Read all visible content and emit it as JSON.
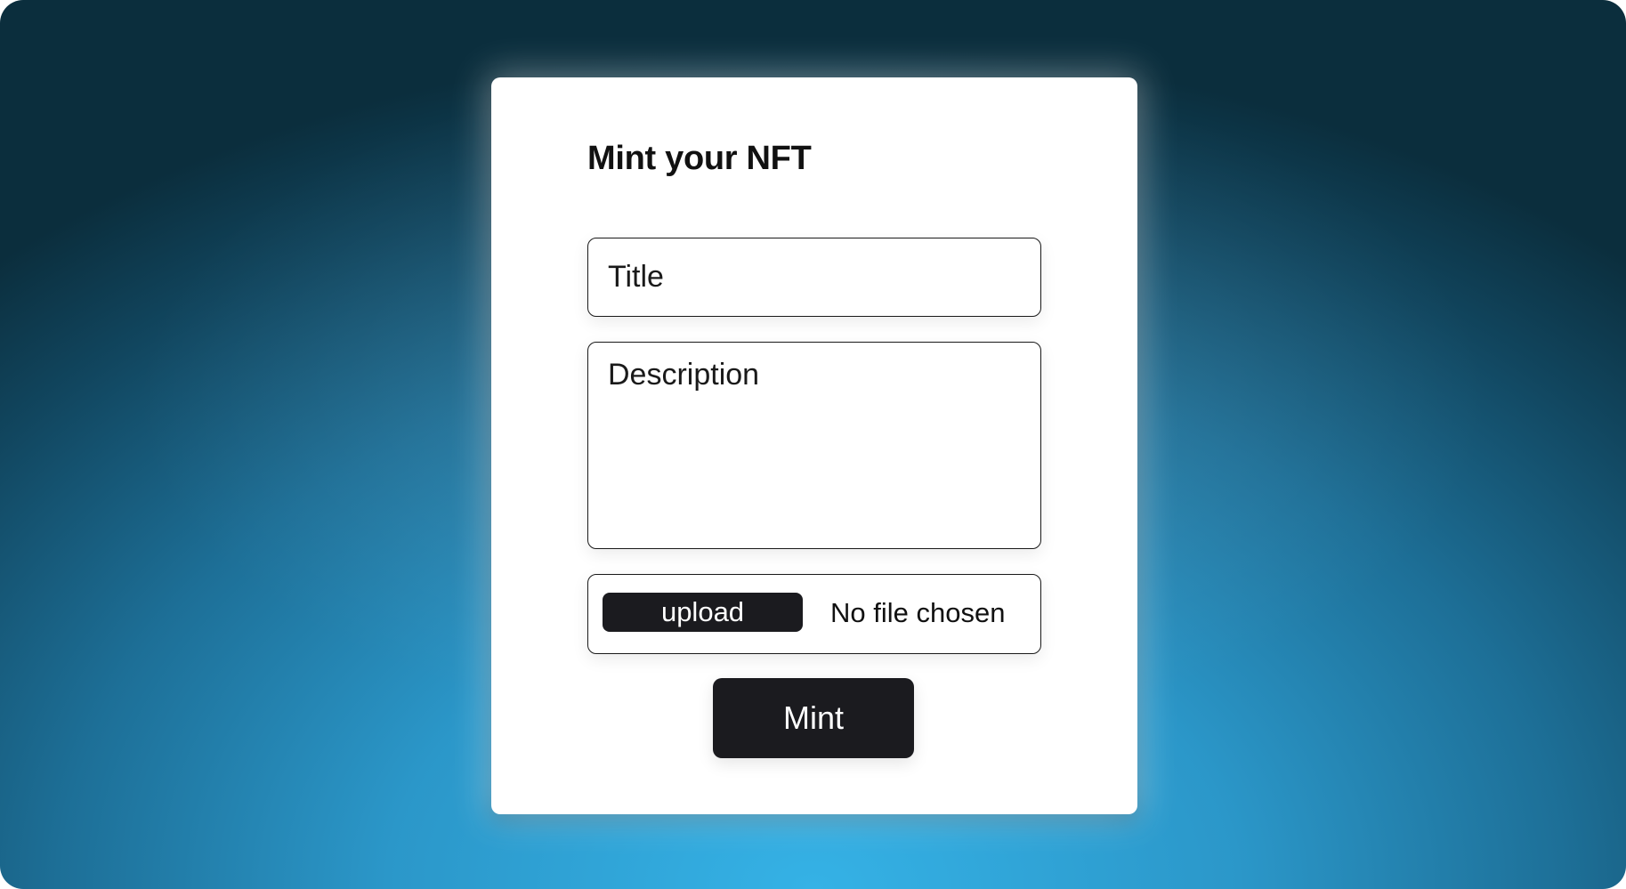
{
  "colors": {
    "background_top": "#0b2e3d",
    "background_bottom": "#35b2e6",
    "card": "#ffffff",
    "button": "#1b1b1f",
    "button_text": "#ffffff",
    "border": "#1a1a1a"
  },
  "form": {
    "title": "Mint your NFT",
    "title_field": {
      "placeholder": "Title",
      "value": ""
    },
    "description_field": {
      "placeholder": "Description",
      "value": ""
    },
    "file_input": {
      "button_label": "upload",
      "status": "No file chosen"
    },
    "submit_label": "Mint"
  }
}
